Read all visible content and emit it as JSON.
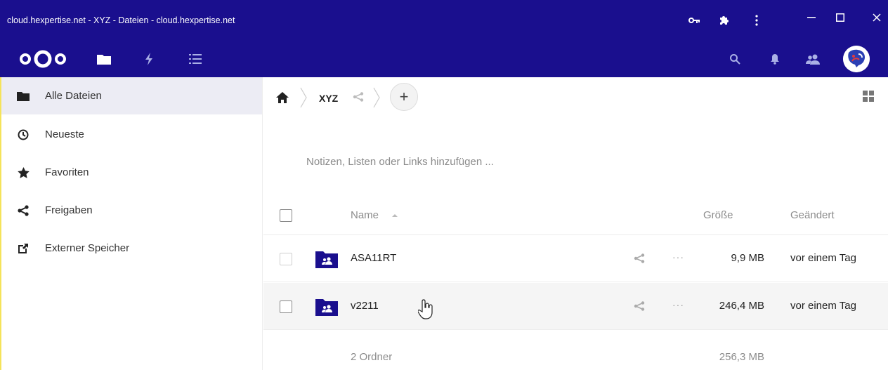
{
  "window": {
    "title": "cloud.hexpertise.net - XYZ - Dateien - cloud.hexpertise.net",
    "icons": [
      "key-icon",
      "puzzle-icon",
      "kebab-menu-icon"
    ],
    "controls": [
      "minimize-icon",
      "maximize-icon",
      "close-icon"
    ]
  },
  "appbar": {
    "logo": "nextcloud-logo",
    "apps": [
      "files-icon",
      "activity-icon",
      "tasks-list-icon"
    ],
    "right_icons": [
      "search-icon",
      "bell-icon",
      "contacts-icon"
    ],
    "avatar": "user-avatar"
  },
  "sidebar": {
    "items": [
      {
        "label": "Alle Dateien",
        "icon": "folder-icon",
        "active": true
      },
      {
        "label": "Neueste",
        "icon": "clock-icon",
        "active": false
      },
      {
        "label": "Favoriten",
        "icon": "star-icon",
        "active": false
      },
      {
        "label": "Freigaben",
        "icon": "share-icon",
        "active": false
      },
      {
        "label": "Externer Speicher",
        "icon": "external-link-icon",
        "active": false
      }
    ]
  },
  "breadcrumb": {
    "home_icon": "home-icon",
    "folder": "XYZ",
    "add_label": "+"
  },
  "notes": {
    "placeholder": "Notizen, Listen oder Links hinzufügen ..."
  },
  "table": {
    "headers": {
      "name": "Name",
      "size": "Größe",
      "modified": "Geändert"
    },
    "rows": [
      {
        "name": "ASA11RT",
        "size": "9,9 MB",
        "modified": "vor einem Tag",
        "more": "···"
      },
      {
        "name": "v2211",
        "size": "246,4 MB",
        "modified": "vor einem Tag",
        "more": "···"
      }
    ],
    "summary": {
      "count": "2 Ordner",
      "size": "256,3 MB"
    }
  },
  "colors": {
    "brand": "#1a0f8e",
    "active_bg": "#ececf4"
  }
}
